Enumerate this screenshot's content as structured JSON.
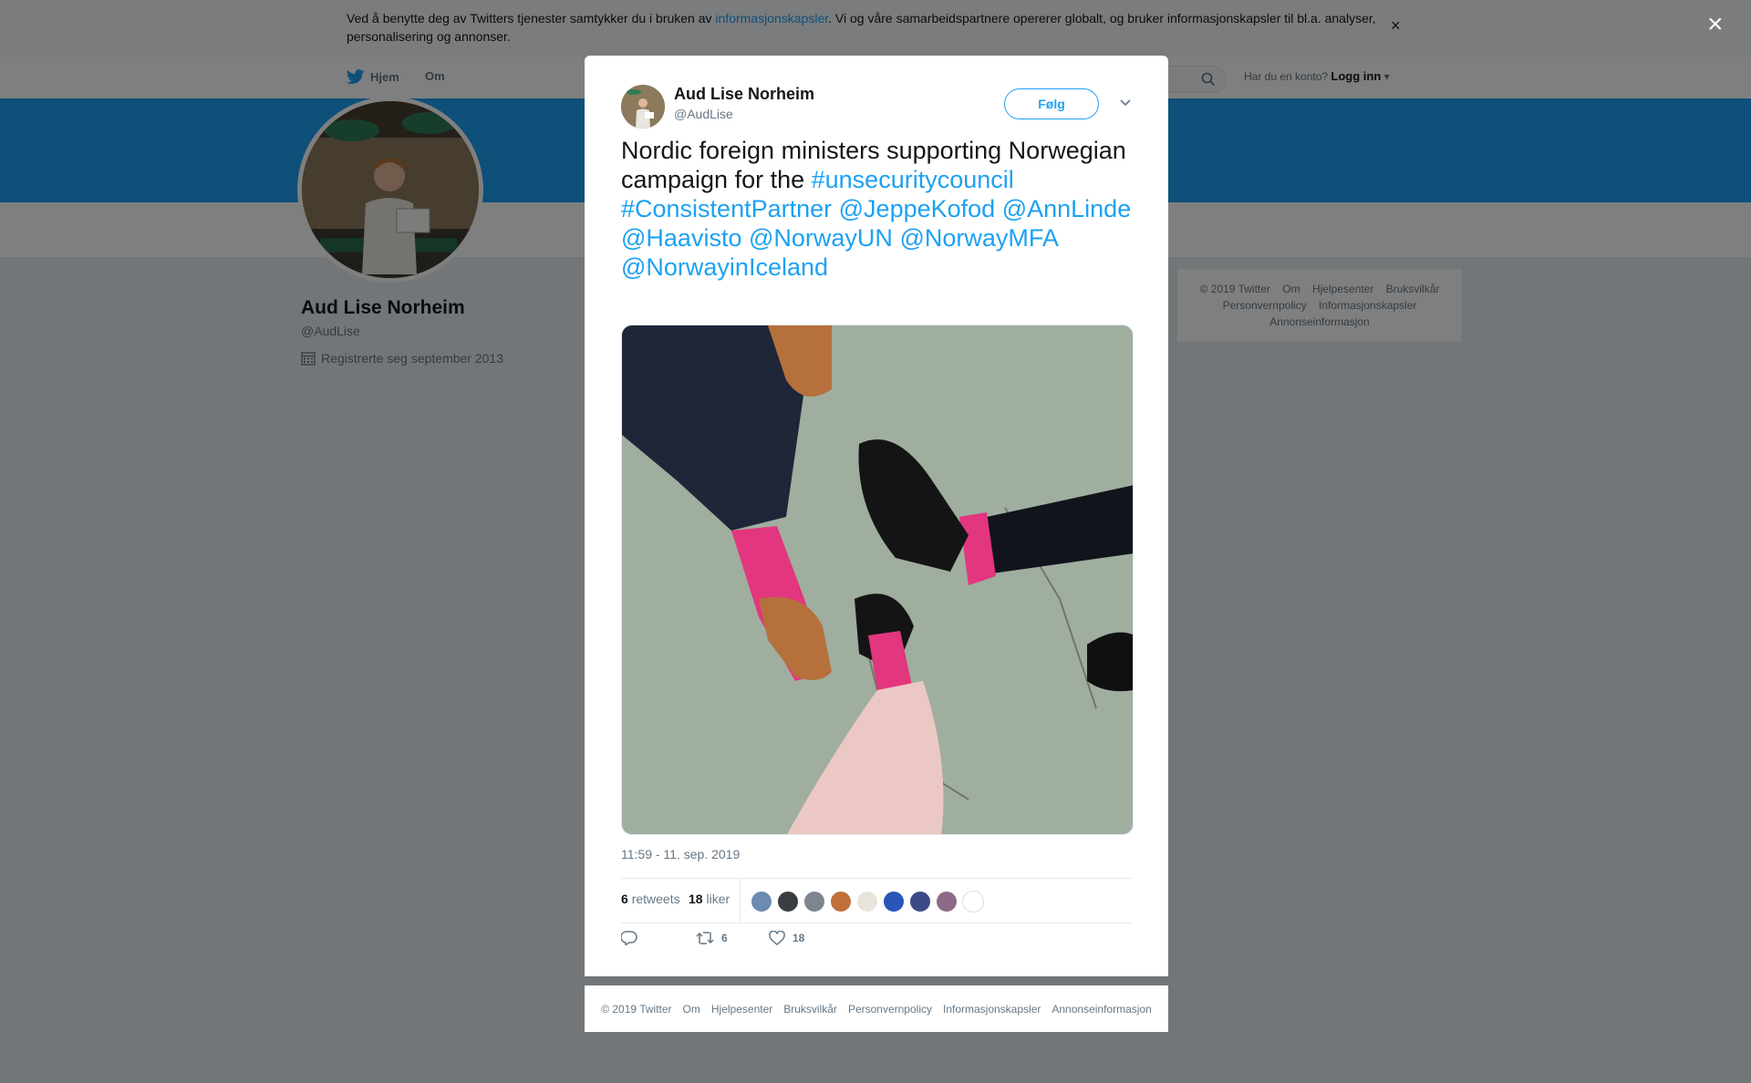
{
  "cookie_bar": {
    "text_before": "Ved å benytte deg av Twitters tjenester samtykker du i bruken av ",
    "link": "informasjonskapsler",
    "text_after": ". Vi og våre samarbeidspartnere opererer globalt, og bruker informasjonskapsler til bl.a. analyser, personalisering og annonser.",
    "close": "×"
  },
  "nav": {
    "home": "Hjem",
    "about": "Om"
  },
  "login": {
    "prompt": "Har du en konto?",
    "action": "Logg inn"
  },
  "profile": {
    "name": "Aud Lise Norheim",
    "handle": "@AudLise",
    "joined": "Registrerte seg september 2013"
  },
  "side_footer": {
    "line1": [
      "© 2019 Twitter",
      "Om",
      "Hjelpesenter",
      "Bruksvilkår"
    ],
    "line2": [
      "Personvernpolicy",
      "Informasjonskapsler"
    ],
    "line3": [
      "Annonseinformasjon"
    ]
  },
  "overlay_close": "×",
  "tweet": {
    "author_name": "Aud Lise Norheim",
    "author_handle": "@AudLise",
    "follow": "Følg",
    "text_plain": "Nordic foreign ministers supporting Norwegian campaign for the ",
    "links": [
      "#unsecuritycouncil",
      "#ConsistentPartner",
      "@JeppeKofod",
      "@AnnLinde",
      "@Haavisto",
      "@NorwayUN",
      "@NorwayMFA",
      "@NorwayinIceland"
    ],
    "timestamp": "11:59 - 11. sep. 2019",
    "retweets_count": "6",
    "retweets_label": "retweets",
    "likes_count": "18",
    "likes_label": "liker",
    "action_retweets": "6",
    "action_likes": "18"
  },
  "modal_footer": [
    "© 2019 Twitter",
    "Om",
    "Hjelpesenter",
    "Bruksvilkår",
    "Personvernpolicy",
    "Informasjonskapsler",
    "Annonseinformasjon"
  ],
  "colors": {
    "brand": "#1da1f2",
    "sock": "#e2367e"
  },
  "icons": [
    "twitter-bird-icon",
    "search-icon",
    "calendar-icon",
    "close-icon",
    "chevron-down-icon",
    "reply-icon",
    "retweet-icon",
    "heart-icon"
  ]
}
